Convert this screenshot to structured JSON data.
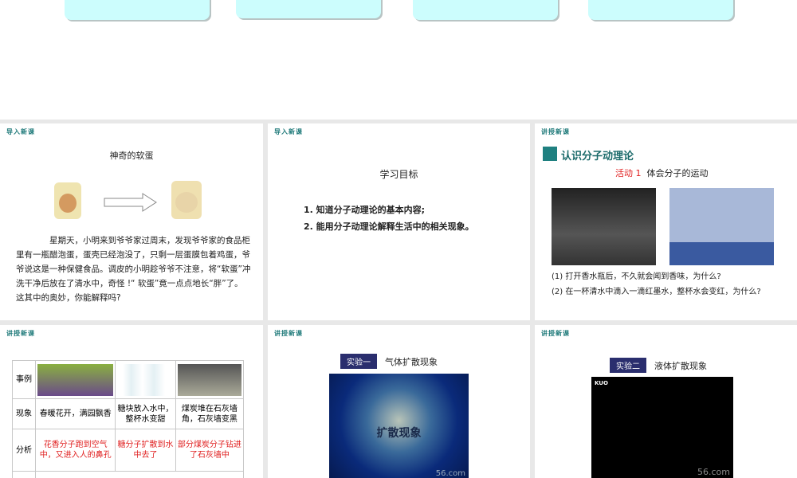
{
  "slides": [
    {
      "section": "导入新课",
      "title": "神奇的软蛋",
      "body": "星期天，小明来到爷爷家过周末，发现爷爷家的食品柜里有一瓶醋泡蛋，蛋壳已经泡没了，只剩一层蛋膜包着鸡蛋，爷爷说这是一种保健食品。调皮的小明趁爷爷不注意，将“软蛋”冲洗干净后放在了清水中，奇怪 !“ 软蛋”竟一点点地长“胖”了。这其中的奥妙，你能解释吗?"
    },
    {
      "section": "导入新课",
      "title": "学习目标",
      "items": [
        "1. 知道分子动理论的基本内容;",
        "2. 能用分子动理论解释生活中的相关现象。"
      ]
    },
    {
      "section": "讲授新课",
      "heading": "认识分子动理论",
      "activity_label": "活动 1",
      "activity_title": "体会分子的运动",
      "q1": "(1) 打开香水瓶后，不久就会闻到香味，为什么?",
      "q2": "(2) 在一杯清水中滴入一滴红墨水，整杯水会变红，为什么?"
    },
    {
      "section": "讲授新课",
      "table": {
        "row_headers": [
          "事例",
          "现象",
          "分析"
        ],
        "phenomena": [
          "春暖花开，满园飘香",
          "糖块放入水中，整杯水变甜",
          "煤炭堆在石灰墙角，石灰墙变黑"
        ],
        "analysis": [
          "花香分子跑到空气中，又进入人的鼻孔",
          "糖分子扩散到水中去了",
          "部分煤炭分子钻进了石灰墙中"
        ]
      }
    },
    {
      "section": "讲授新课",
      "tag": "实验一",
      "title": "气体扩散现象",
      "video_text": "扩散现象",
      "watermark": "56.com"
    },
    {
      "section": "讲授新课",
      "tag": "实验二",
      "title": "液体扩散现象",
      "video_logo": "KUO",
      "watermark": "56.com"
    }
  ]
}
